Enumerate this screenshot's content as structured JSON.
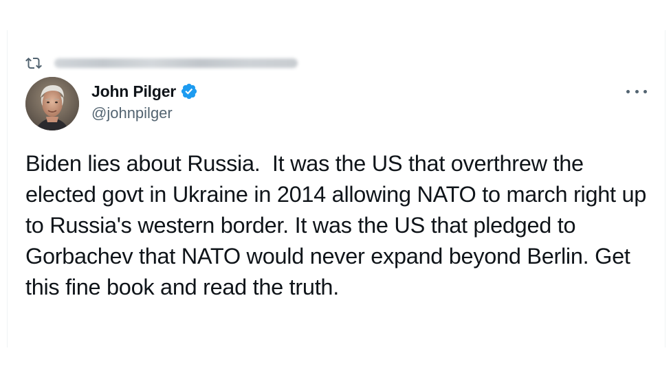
{
  "retweet": {
    "icon": "retweet-icon",
    "retweeted_by_text": "Retweeted (blurred)"
  },
  "author": {
    "display_name": "John Pilger",
    "handle": "@johnpilger",
    "verified_icon": "verified-badge-icon",
    "avatar": "profile-photo"
  },
  "menu": {
    "icon": "more-options-icon"
  },
  "tweet": {
    "text": "Biden lies about Russia.  It was the US that overthrew the elected govt in Ukraine in 2014 allowing NATO to march right up to Russia's western border. It was the US that pledged to Gorbachev that NATO would never expand beyond Berlin. Get this fine book and read the truth."
  },
  "colors": {
    "text_primary": "#0f1419",
    "text_secondary": "#536471",
    "verified_blue": "#1d9bf0",
    "border": "#eff3f4"
  }
}
